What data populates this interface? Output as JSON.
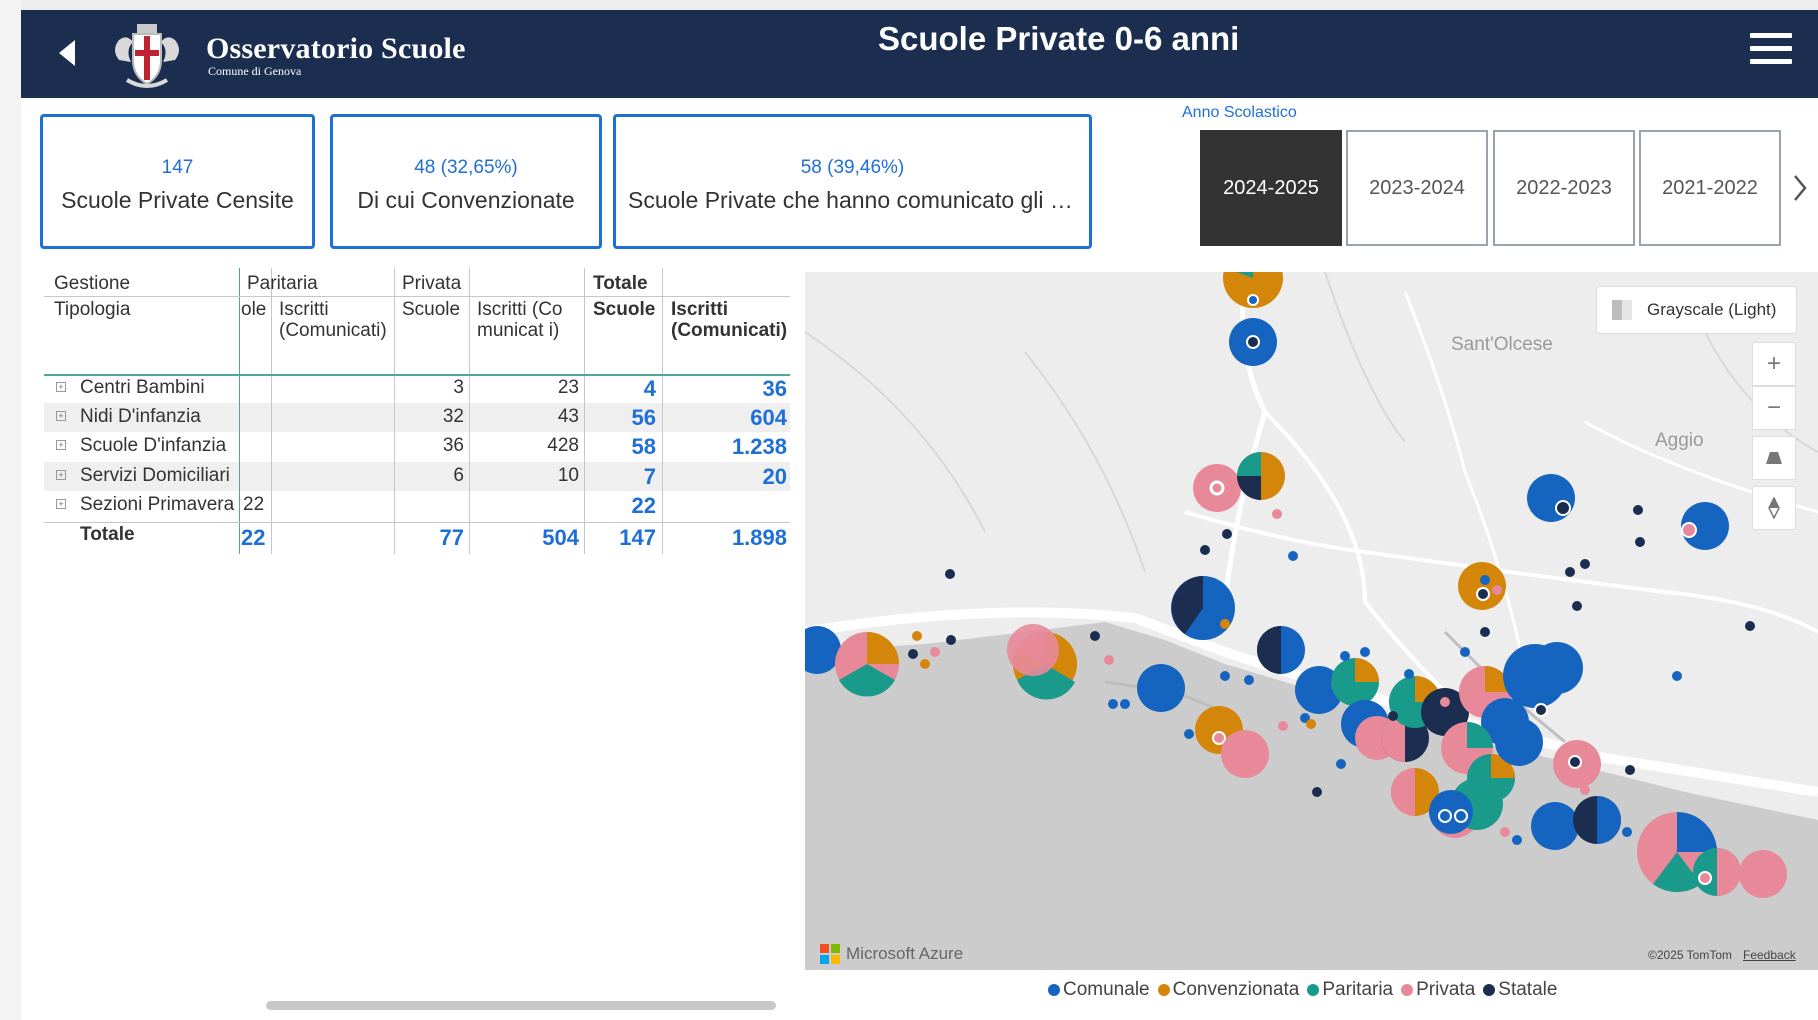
{
  "header": {
    "brand": "Osservatorio Scuole",
    "brand_sub": "Comune di Genova",
    "title": "Scuole Private 0-6 anni"
  },
  "kpis": [
    {
      "value": "147",
      "label": "Scuole Private Censite"
    },
    {
      "value": "48 (32,65%)",
      "label": "Di cui Convenzionate"
    },
    {
      "value": "58 (39,46%)",
      "label": "Scuole Private che hanno comunicato gli is…"
    }
  ],
  "year_filter": {
    "label": "Anno Scolastico",
    "years": [
      "2024-2025",
      "2023-2024",
      "2022-2023",
      "2021-2022"
    ],
    "selected": "2024-2025"
  },
  "matrix": {
    "row_header_1": "Gestione",
    "row_header_2": "Tipologia",
    "groups": [
      "Paritaria",
      "Privata",
      "Totale"
    ],
    "col_scuole_clipped": "ole",
    "col_scuole": "Scuole",
    "col_iscritti": "Iscritti (Comunicati)",
    "col_iscritti_privata": "Iscritti (Comunicat i)",
    "col_iscritti_totale": "Iscritti (Comunicati)",
    "rows": [
      {
        "name": "Centri Bambini",
        "par_scuole": "",
        "par_iscritti": "",
        "priv_scuole": "3",
        "priv_iscritti": "23",
        "tot_scuole": "4",
        "tot_iscritti": "36"
      },
      {
        "name": "Nidi D'infanzia",
        "par_scuole": "",
        "par_iscritti": "",
        "priv_scuole": "32",
        "priv_iscritti": "43",
        "tot_scuole": "56",
        "tot_iscritti": "604"
      },
      {
        "name": "Scuole D'infanzia",
        "par_scuole": "",
        "par_iscritti": "",
        "priv_scuole": "36",
        "priv_iscritti": "428",
        "tot_scuole": "58",
        "tot_iscritti": "1.238"
      },
      {
        "name": "Servizi Domiciliari",
        "par_scuole": "",
        "par_iscritti": "",
        "priv_scuole": "6",
        "priv_iscritti": "10",
        "tot_scuole": "7",
        "tot_iscritti": "20"
      },
      {
        "name": "Sezioni Primavera",
        "par_scuole": "22",
        "par_iscritti": "",
        "priv_scuole": "",
        "priv_iscritti": "",
        "tot_scuole": "22",
        "tot_iscritti": ""
      }
    ],
    "total": {
      "name": "Totale",
      "par_scuole": "22",
      "par_iscritti": "",
      "priv_scuole": "77",
      "priv_iscritti": "504",
      "tot_scuole": "147",
      "tot_iscritti": "1.898"
    }
  },
  "map": {
    "style_label": "Grayscale (Light)",
    "places": [
      "Sant'Olcese",
      "Aggio"
    ],
    "attribution": "Microsoft Azure",
    "copyright": "©2025 TomTom",
    "feedback": "Feedback"
  },
  "legend": [
    {
      "label": "Comunale",
      "color": "#1565c0"
    },
    {
      "label": "Convenzionata",
      "color": "#d4860b"
    },
    {
      "label": "Paritaria",
      "color": "#1a9a8a"
    },
    {
      "label": "Privata",
      "color": "#e8899a"
    },
    {
      "label": "Statale",
      "color": "#1c2e50"
    }
  ]
}
